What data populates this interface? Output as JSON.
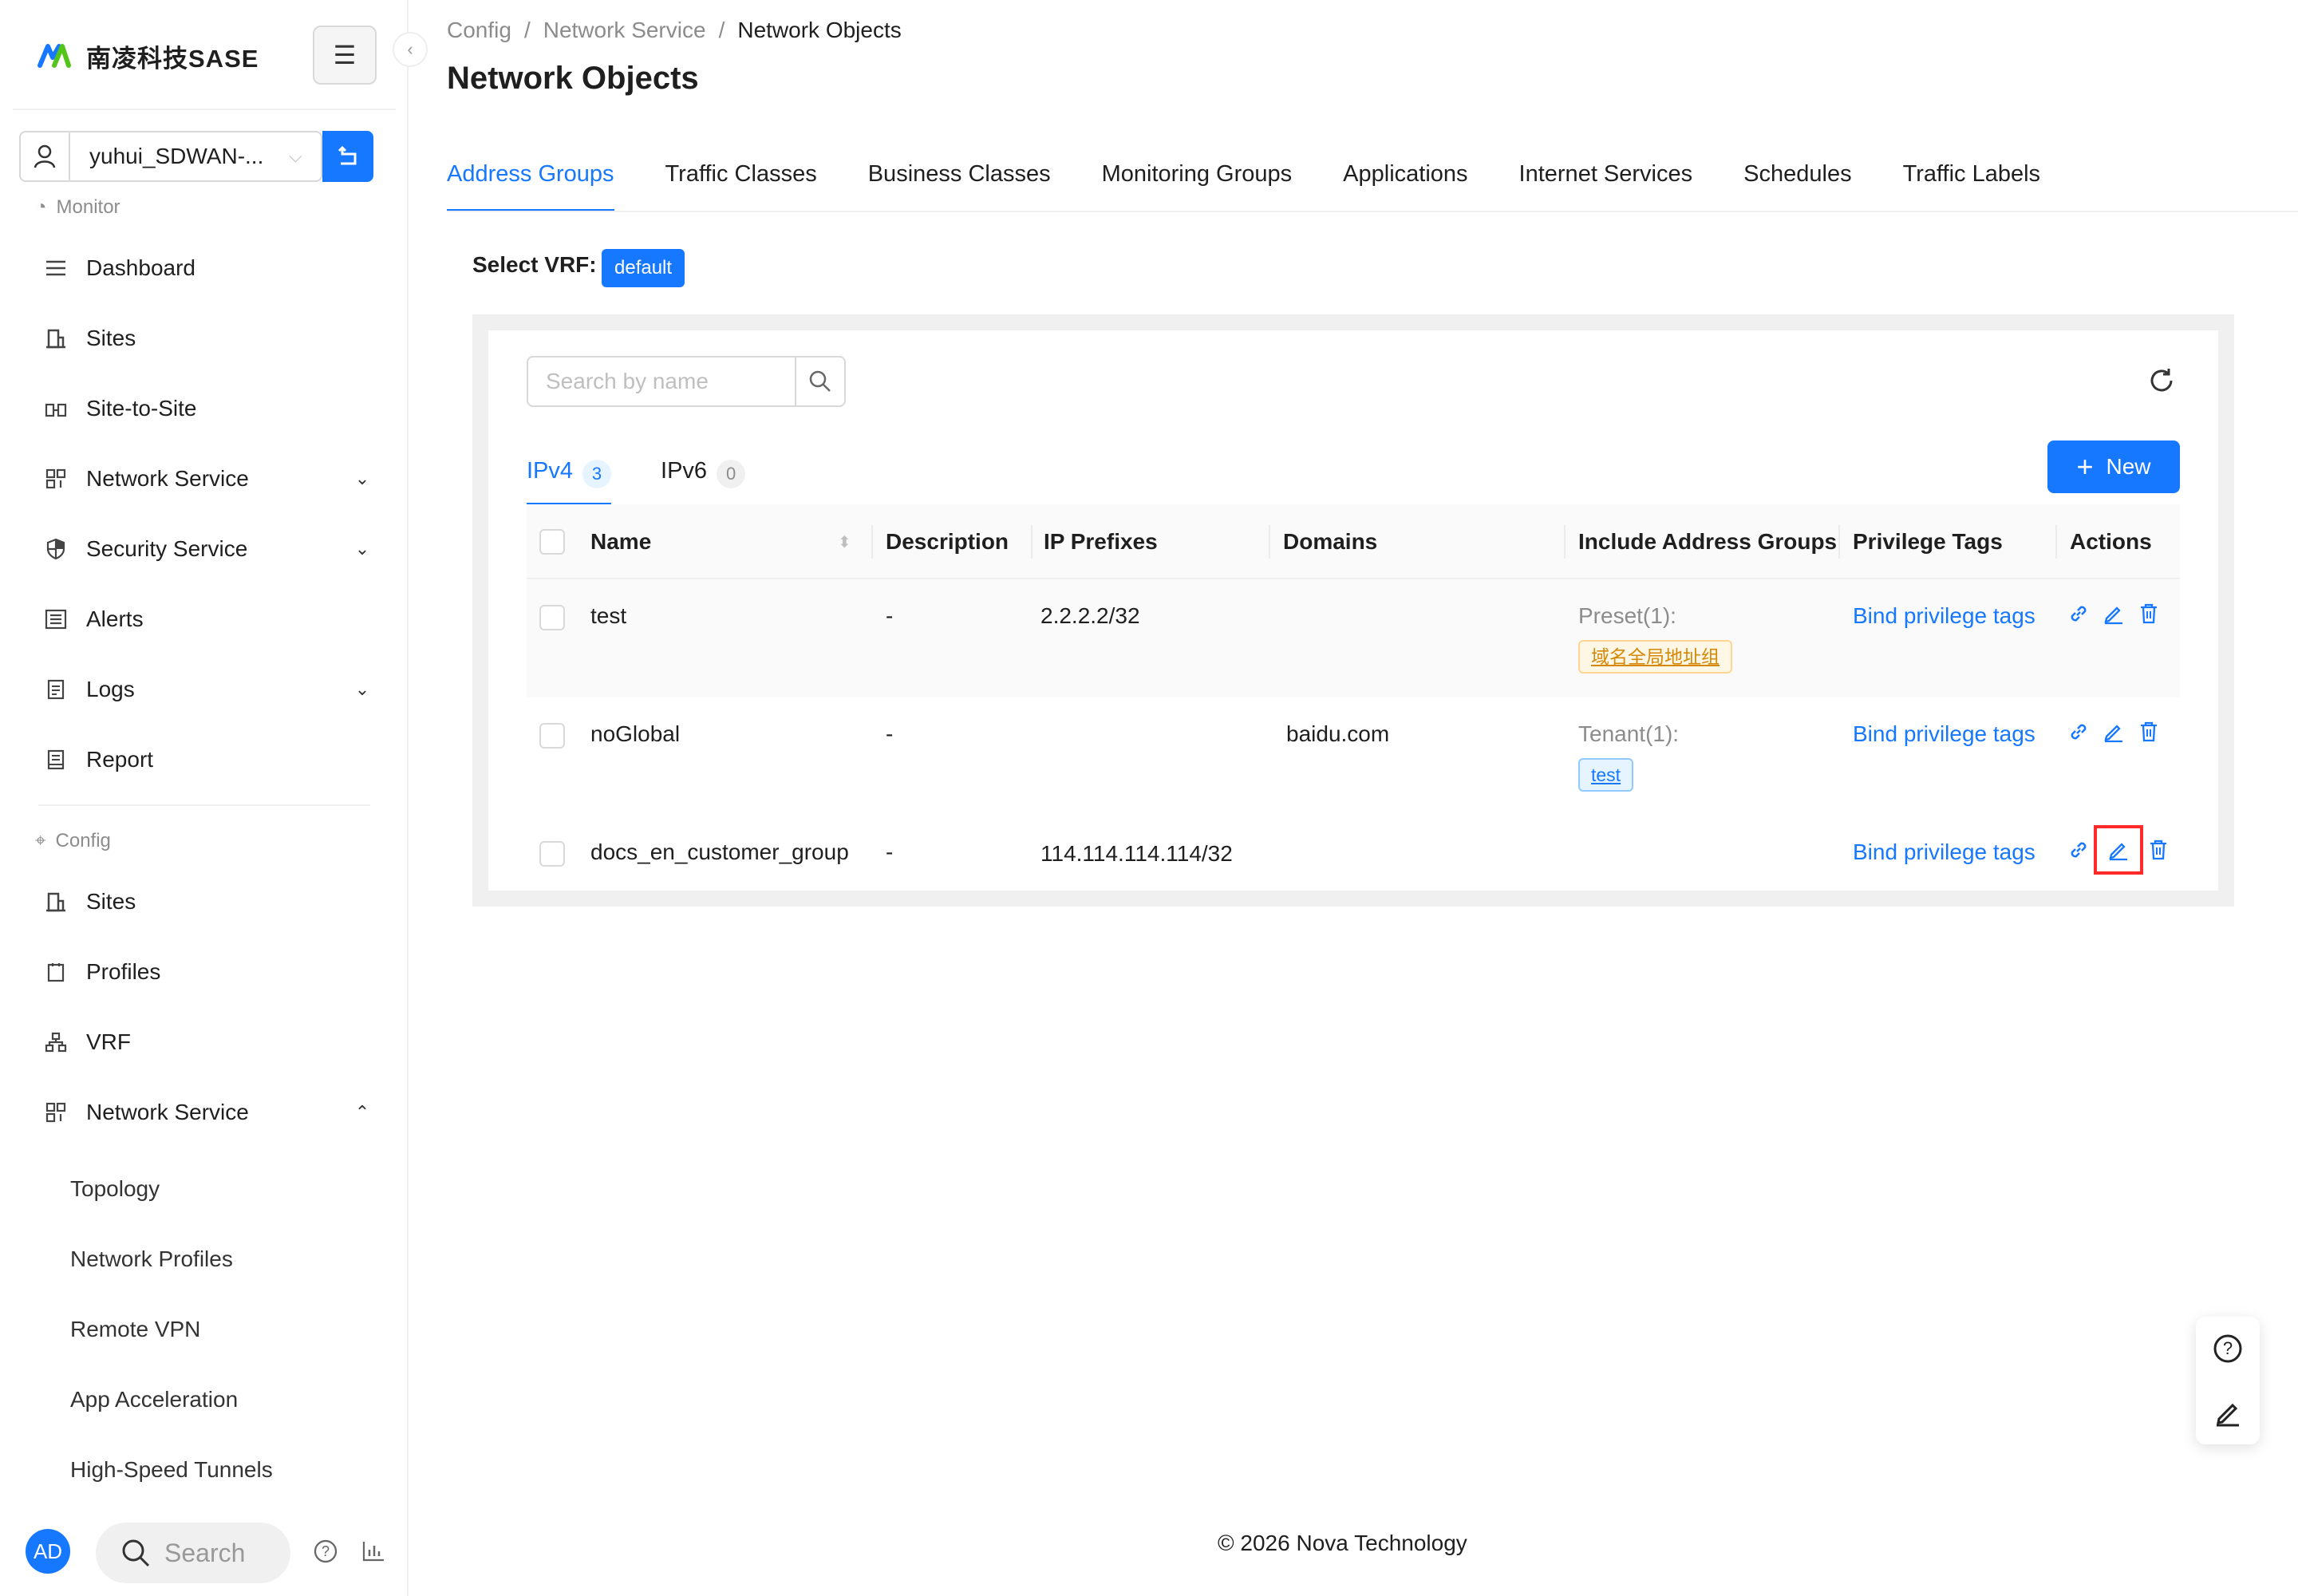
{
  "app": {
    "brand": "南凌科技SASE",
    "brand_color": "#1677ff"
  },
  "tenant": {
    "name": "yuhui_SDWAN-..."
  },
  "sidebar": {
    "monitor_label": "Monitor",
    "monitor_items": [
      {
        "label": "Dashboard",
        "icon": "dashboard-icon"
      },
      {
        "label": "Sites",
        "icon": "building-icon"
      },
      {
        "label": "Site-to-Site",
        "icon": "site-to-site-icon"
      },
      {
        "label": "Network Service",
        "icon": "network-icon",
        "expandable": true
      },
      {
        "label": "Security Service",
        "icon": "shield-icon",
        "expandable": true
      },
      {
        "label": "Alerts",
        "icon": "alert-list-icon"
      },
      {
        "label": "Logs",
        "icon": "log-icon",
        "expandable": true
      },
      {
        "label": "Report",
        "icon": "report-icon"
      }
    ],
    "config_label": "Config",
    "config_items": [
      {
        "label": "Sites",
        "icon": "building-icon"
      },
      {
        "label": "Profiles",
        "icon": "profile-icon"
      },
      {
        "label": "VRF",
        "icon": "vrf-icon"
      },
      {
        "label": "Network Service",
        "icon": "network-icon",
        "expanded": true
      }
    ],
    "network_service_sub": [
      "Topology",
      "Network Profiles",
      "Remote VPN",
      "App Acceleration",
      "High-Speed Tunnels"
    ],
    "avatar": "AD",
    "search_placeholder": "Search"
  },
  "breadcrumb": [
    "Config",
    "Network Service",
    "Network Objects"
  ],
  "page_title": "Network Objects",
  "tabs": [
    "Address Groups",
    "Traffic Classes",
    "Business Classes",
    "Monitoring Groups",
    "Applications",
    "Internet Services",
    "Schedules",
    "Traffic Labels"
  ],
  "active_tab": "Address Groups",
  "vrf": {
    "label": "Select VRF:",
    "value": "default"
  },
  "search": {
    "placeholder": "Search by name"
  },
  "subtabs": [
    {
      "label": "IPv4",
      "count": "3"
    },
    {
      "label": "IPv6",
      "count": "0"
    }
  ],
  "new_button": "New",
  "table": {
    "columns": [
      "Name",
      "Description",
      "IP Prefixes",
      "Domains",
      "Include Address Groups",
      "Privilege Tags",
      "Actions"
    ],
    "rows": [
      {
        "name": "test",
        "description": "-",
        "ip_prefixes": "2.2.2.2/32",
        "domains": "",
        "include_label": "Preset(1):",
        "include_tag": "域名全局地址组",
        "include_tag_color": "gold",
        "privilege": "Bind privilege tags"
      },
      {
        "name": "noGlobal",
        "description": "-",
        "ip_prefixes": "",
        "domains": "baidu.com",
        "include_label": "Tenant(1):",
        "include_tag": "test",
        "include_tag_color": "blue",
        "privilege": "Bind privilege tags"
      },
      {
        "name": "docs_en_customer_group",
        "description": "-",
        "ip_prefixes": "114.114.114.114/32",
        "domains": "",
        "include_label": "",
        "include_tag": "",
        "include_tag_color": "",
        "privilege": "Bind privilege tags",
        "edit_highlighted": true
      }
    ]
  },
  "footer": "© 2026 Nova Technology"
}
